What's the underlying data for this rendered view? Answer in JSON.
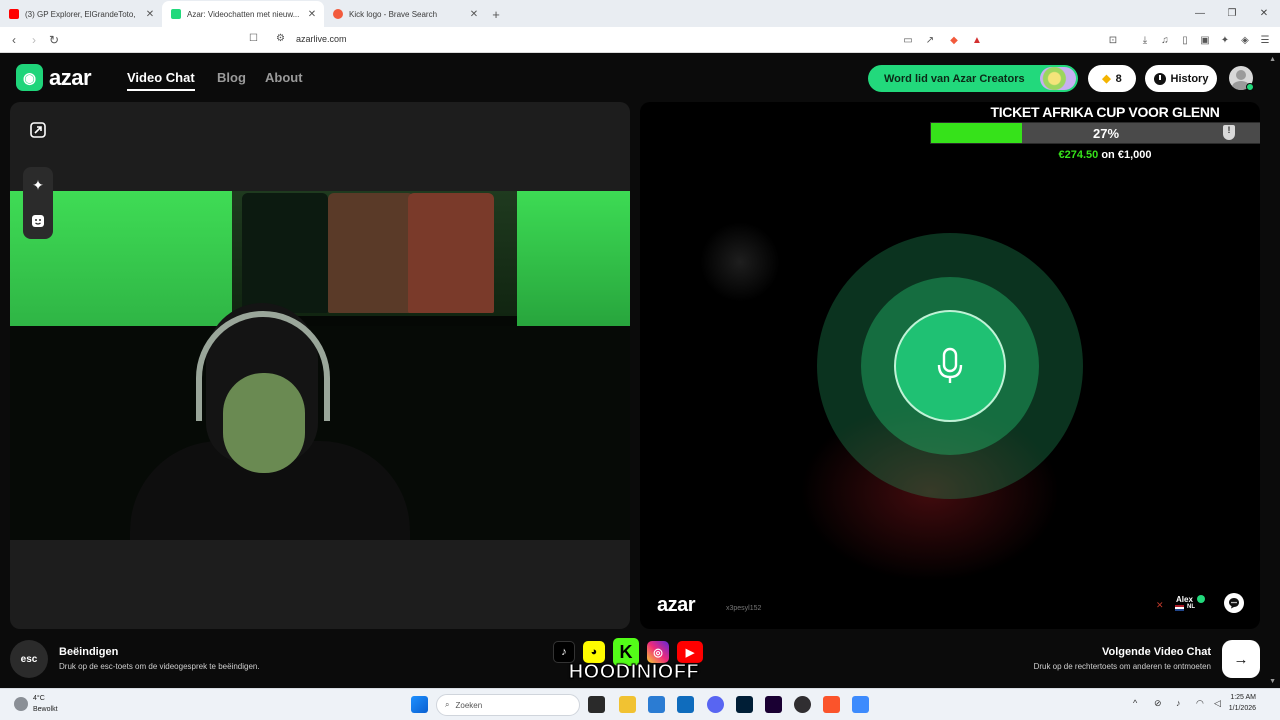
{
  "browser": {
    "tabs": [
      {
        "title": "(3) GP Explorer, ElGrandeToto, Zed, L...",
        "color": "#ff0000",
        "active": false
      },
      {
        "title": "Azar: Videochatten met nieuw...",
        "color": "#22d97c",
        "active": true
      },
      {
        "title": "Kick logo - Brave Search",
        "color": "#f25a3c",
        "active": false
      }
    ],
    "new_tab": "+",
    "url": "azarlive.com"
  },
  "header": {
    "logo_text": "azar",
    "nav": [
      "Video Chat",
      "Blog",
      "About"
    ],
    "creators_cta": "Word lid van Azar Creators",
    "gems_count": "8",
    "history_label": "History"
  },
  "donation_goal": {
    "title": "TICKET AFRIKA CUP VOOR GLENN",
    "percent_label": "27%",
    "progress": 0.27,
    "raised": "€274.50",
    "separator": "on",
    "target": "€1,000"
  },
  "partner": {
    "watermark": "azar",
    "id": "x3pesyl152",
    "name": "Alex",
    "country": "NL"
  },
  "footer": {
    "esc_key": "esc",
    "end_title": "Beëindigen",
    "end_desc": "Druk op de esc-toets om de videogesprek te beëindigen.",
    "next_title": "Volgende Video Chat",
    "next_desc": "Druk op de rechtertoets om anderen te ontmoeten"
  },
  "overlay": {
    "socials": [
      "tiktok-icon",
      "snapchat-icon",
      "kick-icon",
      "instagram-icon",
      "youtube-icon"
    ],
    "handle": "HOODINIOFF"
  },
  "taskbar": {
    "temp": "4°C",
    "weather": "Bewolkt",
    "search_placeholder": "Zoeken",
    "time": "1:25 AM",
    "date": "1/1/2026"
  },
  "colors": {
    "brand_green": "#22d97c",
    "goal_fill": "#36e21a"
  }
}
